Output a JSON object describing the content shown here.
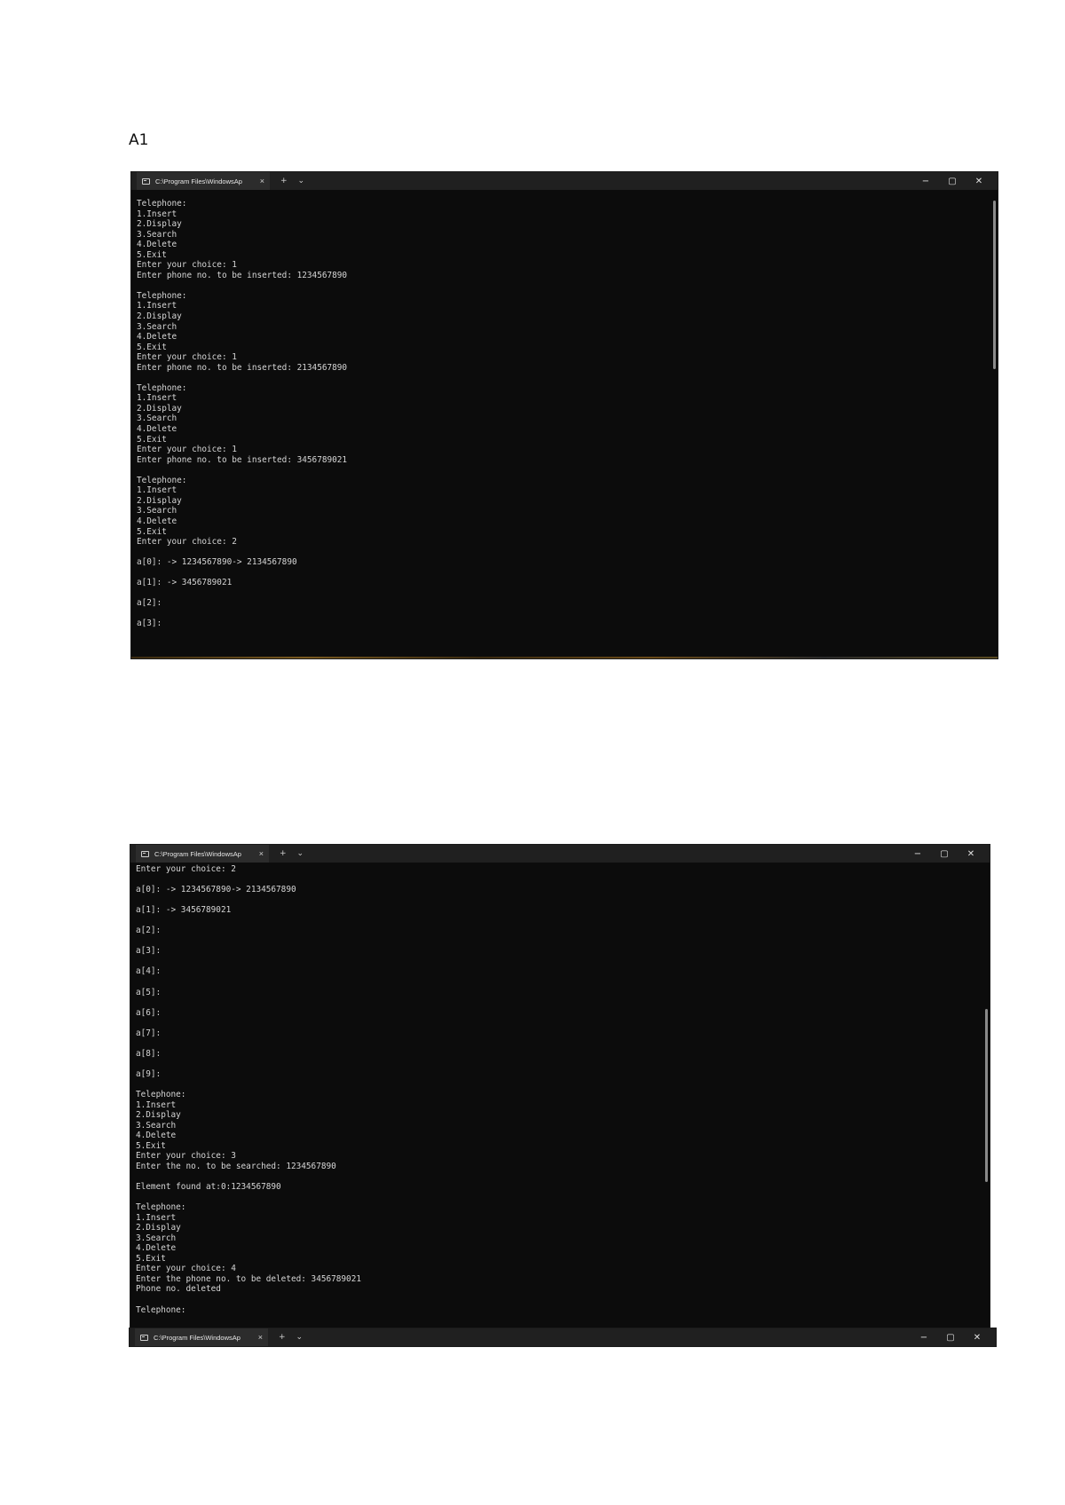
{
  "doc_label": "A1",
  "window1": {
    "tab_title": "C:\\Program Files\\WindowsAp",
    "tab_close": "×",
    "new_tab": "+",
    "tab_menu": "⌄",
    "minimize": "−",
    "maximize": "▢",
    "close": "✕",
    "output": "Telephone:\n1.Insert\n2.Display\n3.Search\n4.Delete\n5.Exit\nEnter your choice: 1\nEnter phone no. to be inserted: 1234567890\n\nTelephone:\n1.Insert\n2.Display\n3.Search\n4.Delete\n5.Exit\nEnter your choice: 1\nEnter phone no. to be inserted: 2134567890\n\nTelephone:\n1.Insert\n2.Display\n3.Search\n4.Delete\n5.Exit\nEnter your choice: 1\nEnter phone no. to be inserted: 3456789021\n\nTelephone:\n1.Insert\n2.Display\n3.Search\n4.Delete\n5.Exit\nEnter your choice: 2\n\na[0]: -> 1234567890-> 2134567890\n\na[1]: -> 3456789021\n\na[2]:\n\na[3]:"
  },
  "window2": {
    "tab_title": "C:\\Program Files\\WindowsAp",
    "tab_close": "×",
    "new_tab": "+",
    "tab_menu": "⌄",
    "minimize": "−",
    "maximize": "▢",
    "close": "✕",
    "output": "Enter your choice: 2\n\na[0]: -> 1234567890-> 2134567890\n\na[1]: -> 3456789021\n\na[2]:\n\na[3]:\n\na[4]:\n\na[5]:\n\na[6]:\n\na[7]:\n\na[8]:\n\na[9]:\n\nTelephone:\n1.Insert\n2.Display\n3.Search\n4.Delete\n5.Exit\nEnter your choice: 3\nEnter the no. to be searched: 1234567890\n\nElement found at:0:1234567890\n\nTelephone:\n1.Insert\n2.Display\n3.Search\n4.Delete\n5.Exit\nEnter your choice: 4\nEnter the phone no. to be deleted: 3456789021\nPhone no. deleted\n\nTelephone:"
  },
  "window3": {
    "tab_title": "C:\\Program Files\\WindowsAp",
    "tab_close": "×",
    "new_tab": "+",
    "tab_menu": "⌄",
    "minimize": "−",
    "maximize": "▢",
    "close": "✕"
  }
}
